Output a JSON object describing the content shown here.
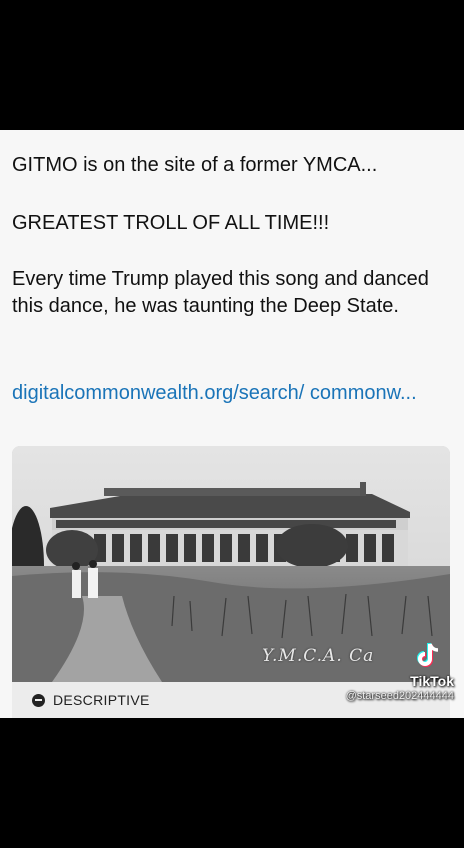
{
  "post": {
    "line1": "GITMO is on the site of a former YMCA...",
    "line2": "GREATEST TROLL OF ALL TIME!!!",
    "line3": "Every time Trump played this song and danced this dance, he was taunting the Deep State.",
    "link": "digitalcommonwealth.org/search/ commonw...",
    "photo_caption": "Y.M.C.A. Ca",
    "label": "DESCRIPTIVE"
  },
  "watermark": {
    "brand": "TikTok",
    "username": "@starseed202444444"
  }
}
